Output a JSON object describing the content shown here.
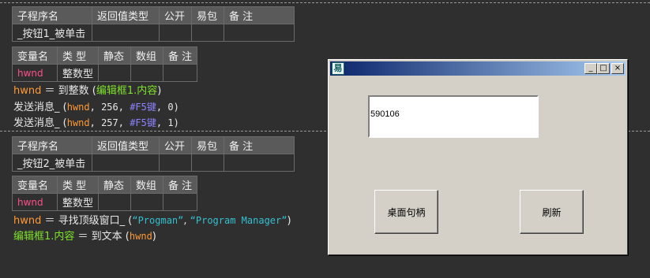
{
  "sub1": {
    "headers": [
      "子程序名",
      "返回值类型",
      "公开",
      "易包",
      "备 注"
    ],
    "name": "_按钮1_被单击",
    "var_headers": [
      "变量名",
      "类 型",
      "静态",
      "数组",
      "备 注"
    ],
    "var_name": "hwnd",
    "var_type": "整数型",
    "lines": [
      {
        "a": "hwnd",
        "b": " ＝ 到整数 (",
        "c": "编辑框1.内容",
        "d": ")"
      },
      {
        "a": "发送消息_ (",
        "b": "hwnd",
        "c": ", 256, ",
        "d": "#F5键",
        "e": ", 0)"
      },
      {
        "a": "发送消息_ (",
        "b": "hwnd",
        "c": ", 257, ",
        "d": "#F5键",
        "e": ", 1)"
      }
    ]
  },
  "sub2": {
    "headers": [
      "子程序名",
      "返回值类型",
      "公开",
      "易包",
      "备 注"
    ],
    "name": "_按钮2_被单击",
    "var_headers": [
      "变量名",
      "类 型",
      "静态",
      "数组",
      "备 注"
    ],
    "var_name": "hwnd",
    "var_type": "整数型",
    "line1": {
      "a": "hwnd",
      "b": " ＝ 寻找顶级窗口_ (",
      "c": "“Progman”",
      "d": ", ",
      "e": "“Program Manager”",
      "f": ")"
    },
    "line2": {
      "a": "编辑框1.内容",
      "b": " ＝ 到文本 (",
      "c": "hwnd",
      "d": ")"
    }
  },
  "window": {
    "icon": "易",
    "minimize": "_",
    "maximize": "□",
    "close": "×",
    "edit_value": "590106",
    "button1": "桌面句柄",
    "button2": "刷新"
  }
}
